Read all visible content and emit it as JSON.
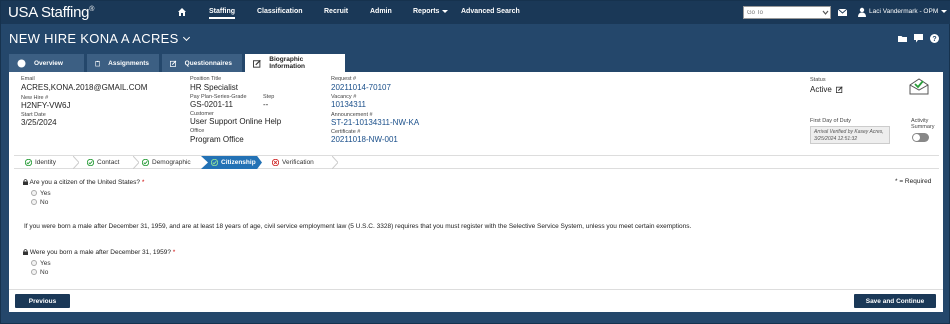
{
  "app": {
    "brand": "USA Staffing",
    "brand_mark": "®",
    "nav": [
      "Staffing",
      "Classification",
      "Recruit",
      "Admin",
      "Reports",
      "Advanced Search"
    ],
    "goto_placeholder": "Go To",
    "user": "Laci Vandermark - OPM"
  },
  "page": {
    "title": "NEW HIRE KONA A ACRES"
  },
  "tabs": [
    {
      "label": "Overview",
      "icon": "overview-icon"
    },
    {
      "label": "Assignments",
      "icon": "clipboard-icon"
    },
    {
      "label": "Questionnaires",
      "icon": "edit-icon"
    },
    {
      "label": "Biographic Information",
      "icon": "edit-icon"
    }
  ],
  "info": {
    "email_label": "Email",
    "email": "ACRES,KONA.2018@GMAIL.COM",
    "new_hire_label": "New Hire #",
    "new_hire": "H2NFY-VW6J",
    "start_date_label": "Start Date",
    "start_date": "3/25/2024",
    "position_title_label": "Position Title",
    "position_title": "HR Specialist",
    "pay_plan_label": "Pay Plan-Series-Grade",
    "pay_plan": "GS-0201-11",
    "step_label": "Step",
    "step": "--",
    "customer_label": "Customer",
    "customer": "User Support Online Help",
    "office_label": "Office",
    "office": "Program Office",
    "request_label": "Request #",
    "request": "20211014-70107",
    "vacancy_label": "Vacancy #",
    "vacancy": "10134311",
    "announcement_label": "Announcement #",
    "announcement": "ST-21-10134311-NW-KA",
    "certificate_label": "Certificate #",
    "certificate": "20211018-NW-001",
    "status_label": "Status",
    "status": "Active",
    "first_day_label": "First Day of Duty",
    "first_day_note": "Arrival Verified by Kasey Acres, 3/25/2024 12:51:32",
    "activity_label": "Activity Summary"
  },
  "steps": [
    {
      "label": "Identity",
      "state": "done"
    },
    {
      "label": "Contact",
      "state": "done"
    },
    {
      "label": "Demographic",
      "state": "done"
    },
    {
      "label": "Citizenship",
      "state": "active"
    },
    {
      "label": "Verification",
      "state": "error"
    }
  ],
  "form": {
    "required_note": "* = Required",
    "q1": "Are you a citizen of the United States?",
    "q1_options": [
      "Yes",
      "No"
    ],
    "info_text": "If you were born a male after December 31, 1959, and are at least 18 years of age, civil service employment law (5 U.S.C. 3328) requires that you must register with the Selective Service System, unless you meet certain exemptions.",
    "q2": "Were you born a male after December 31, 1959?",
    "q2_options": [
      "Yes",
      "No"
    ]
  },
  "buttons": {
    "previous": "Previous",
    "save_continue": "Save and Continue"
  },
  "colors": {
    "navy": "#1a3857",
    "background": "#24476b",
    "active_step": "#2372b5",
    "check_green": "#2a9d3a",
    "error_red": "#d02b2b"
  }
}
